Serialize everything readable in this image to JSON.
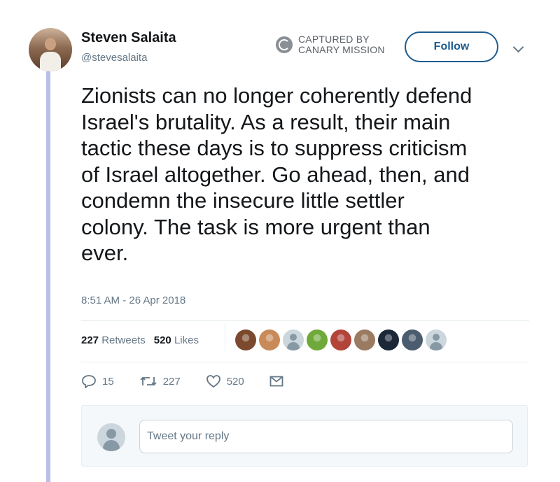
{
  "author": {
    "name": "Steven Salaita",
    "handle": "@stevesalaita"
  },
  "capture_badge": {
    "line1": "CAPTURED BY",
    "line2": "CANARY MISSION",
    "icon": "canary-mission-logo-icon"
  },
  "follow_button": {
    "label": "Follow"
  },
  "tweet": {
    "text": "Zionists can no longer coherently defend\nIsrael's brutality.  As a result, their main\ntactic these days is to suppress criticism\nof Israel altogether.  Go ahead, then, and\ncondemn the insecure little settler\ncolony.  The task is more urgent than\never.",
    "timestamp": "8:51 AM - 26 Apr 2018"
  },
  "stats": {
    "retweets_count": "227",
    "retweets_label": "Retweets",
    "likes_count": "520",
    "likes_label": "Likes"
  },
  "liker_avatars": [
    "#7b4a2e",
    "#c98a5a",
    "default",
    "#6fa93a",
    "#b2443a",
    "#9a7b62",
    "#1c2738",
    "#4a5c6e",
    "default"
  ],
  "actions": {
    "reply_count": "15",
    "retweet_count": "227",
    "like_count": "520"
  },
  "reply": {
    "placeholder": "Tweet your reply"
  },
  "colors": {
    "accent": "#1d5c8f",
    "thread_line": "#b8bfe8",
    "muted": "#657786"
  }
}
